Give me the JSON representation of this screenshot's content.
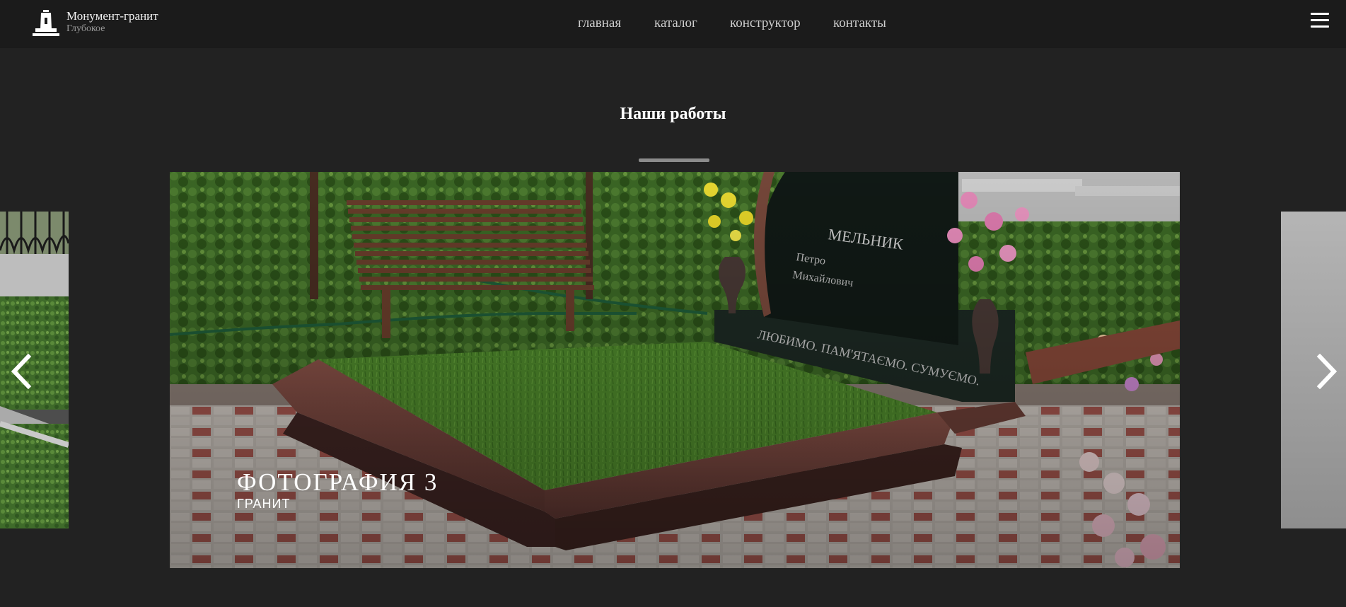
{
  "header": {
    "brand_title": "Монумент-гранит",
    "brand_subtitle": "Глубокое",
    "logo_icon": "monument-logo-icon",
    "menu_icon": "hamburger-menu-icon"
  },
  "nav": {
    "items": [
      {
        "label": "главная"
      },
      {
        "label": "каталог"
      },
      {
        "label": "конструктор"
      },
      {
        "label": "контакты"
      }
    ]
  },
  "section": {
    "title": "Наши работы"
  },
  "slider": {
    "current_slide": {
      "title": "ФОТОГРАФИЯ 3",
      "subtitle": "ГРАНИТ"
    },
    "prev_icon": "chevron-left-icon",
    "next_icon": "chevron-right-icon"
  },
  "colors": {
    "page_background": "#222222",
    "header_background": "#1b1b1b",
    "nav_text": "#cfcfcf",
    "accent_rule": "#8c8c8c"
  }
}
